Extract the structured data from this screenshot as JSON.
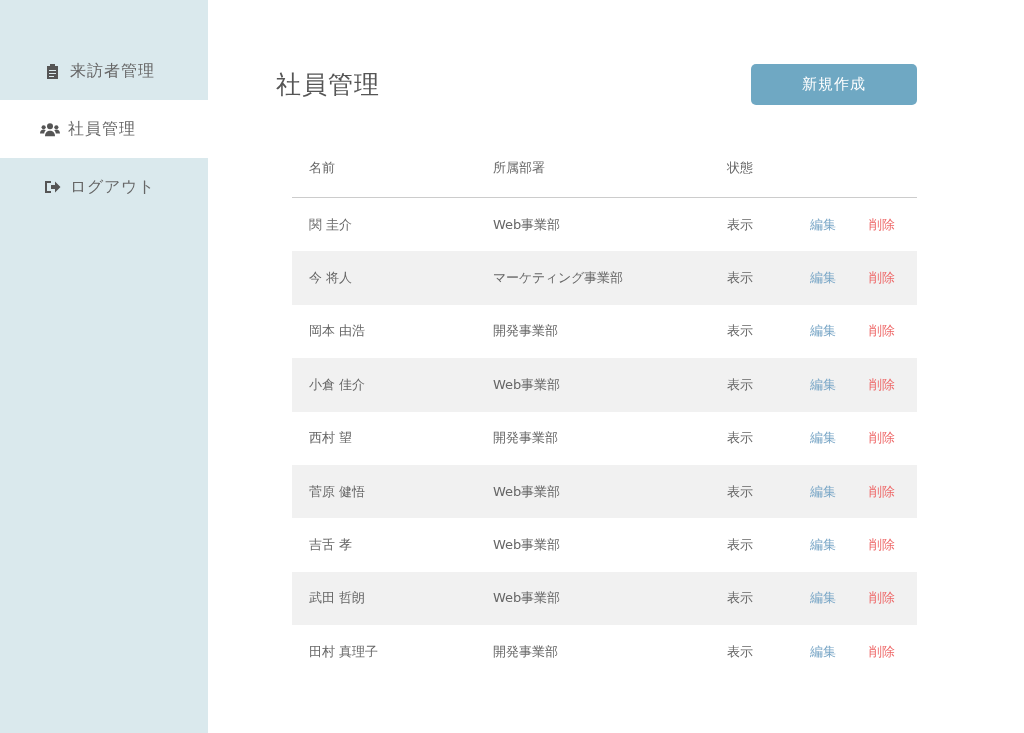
{
  "sidebar": {
    "items": [
      {
        "label": "来訪者管理",
        "kind": "visitors",
        "selected": false
      },
      {
        "label": "社員管理",
        "kind": "employees",
        "selected": true
      },
      {
        "label": "ログアウト",
        "kind": "logout",
        "selected": false
      }
    ]
  },
  "page_title": "社員管理",
  "new_button": "新規作成",
  "table": {
    "columns": [
      "名前",
      "所属部署",
      "状態"
    ],
    "rows": [
      {
        "name": "関 圭介",
        "department": "Web事業部",
        "status": "表示",
        "edit": "編集",
        "delete": "削除"
      },
      {
        "name": "今 将人",
        "department": "マーケティング事業部",
        "status": "表示",
        "edit": "編集",
        "delete": "削除"
      },
      {
        "name": "岡本 由浩",
        "department": "開発事業部",
        "status": "表示",
        "edit": "編集",
        "delete": "削除"
      },
      {
        "name": "小倉 佳介",
        "department": "Web事業部",
        "status": "表示",
        "edit": "編集",
        "delete": "削除"
      },
      {
        "name": "西村 望",
        "department": "開発事業部",
        "status": "表示",
        "edit": "編集",
        "delete": "削除"
      },
      {
        "name": "菅原 健悟",
        "department": "Web事業部",
        "status": "表示",
        "edit": "編集",
        "delete": "削除"
      },
      {
        "name": "吉舌 孝",
        "department": "Web事業部",
        "status": "表示",
        "edit": "編集",
        "delete": "削除"
      },
      {
        "name": "武田 哲朗",
        "department": "Web事業部",
        "status": "表示",
        "edit": "編集",
        "delete": "削除"
      },
      {
        "name": "田村 真理子",
        "department": "開発事業部",
        "status": "表示",
        "edit": "編集",
        "delete": "削除"
      }
    ]
  }
}
